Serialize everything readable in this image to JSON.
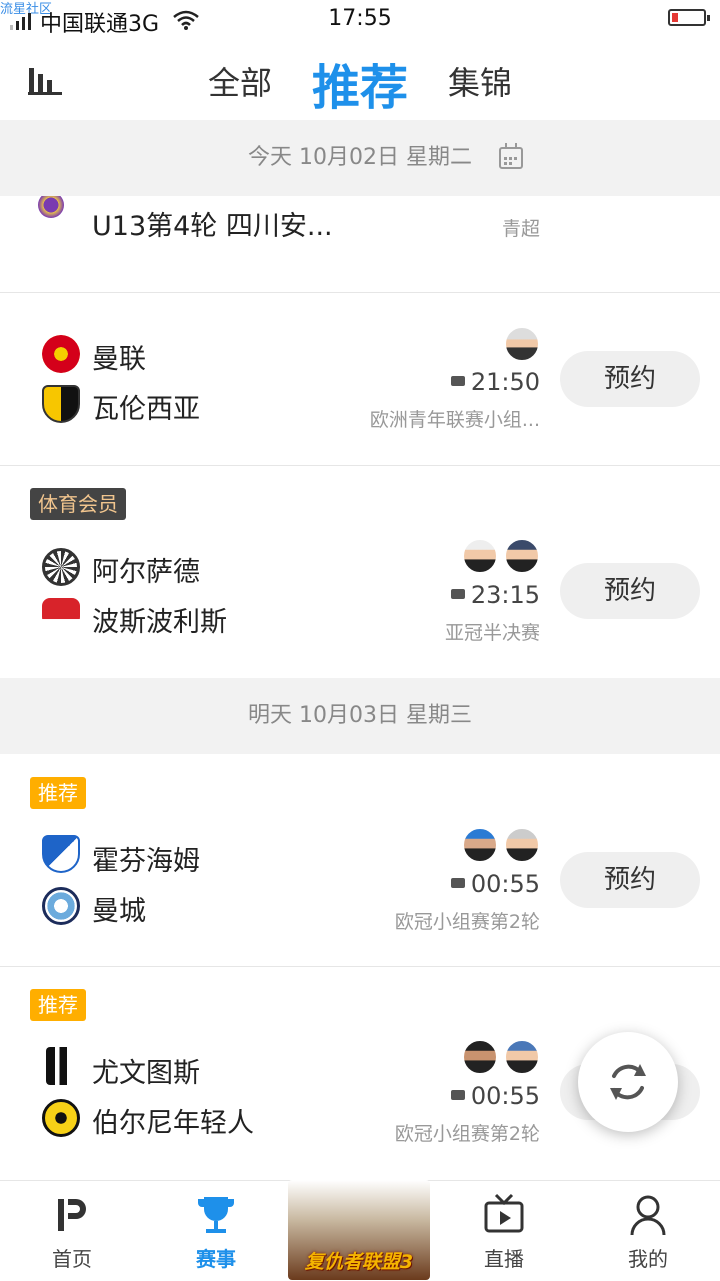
{
  "status_bar": {
    "watermark": "流星社区",
    "carrier": "中国联通3G",
    "time": "17:55",
    "battery_color": "#e53935"
  },
  "top_nav": {
    "tabs": [
      "全部",
      "推荐",
      "集锦"
    ],
    "active_tab": "推荐",
    "accent": "#1e90ea"
  },
  "date_today": "今天 10月02日 星期二",
  "date_tomorrow": "明天 10月03日 星期三",
  "partial_match": {
    "title": "U13第4轮 四川安...",
    "league": "青超"
  },
  "matches": [
    {
      "home": "曼联",
      "away": "瓦伦西亚",
      "time": "21:50",
      "league": "欧洲青年联赛小组...",
      "button": "预约"
    },
    {
      "badge": "体育会员",
      "home": "阿尔萨德",
      "away": "波斯波利斯",
      "time": "23:15",
      "league": "亚冠半决赛",
      "button": "预约"
    },
    {
      "badge": "推荐",
      "home": "霍芬海姆",
      "away": "曼城",
      "time": "00:55",
      "league": "欧冠小组赛第2轮",
      "button": "预约"
    },
    {
      "badge": "推荐",
      "home": "尤文图斯",
      "away": "伯尔尼年轻人",
      "time": "00:55",
      "league": "欧冠小组赛第2轮"
    }
  ],
  "bottom_nav": {
    "items": [
      "首页",
      "赛事",
      "直播",
      "我的"
    ],
    "active": "赛事",
    "promo_text": "复仇者联盟3"
  },
  "icons": [
    "stats-icon",
    "calendar-icon",
    "camera-icon",
    "refresh-icon",
    "home-icon",
    "trophy-icon",
    "tv-icon",
    "profile-icon"
  ]
}
